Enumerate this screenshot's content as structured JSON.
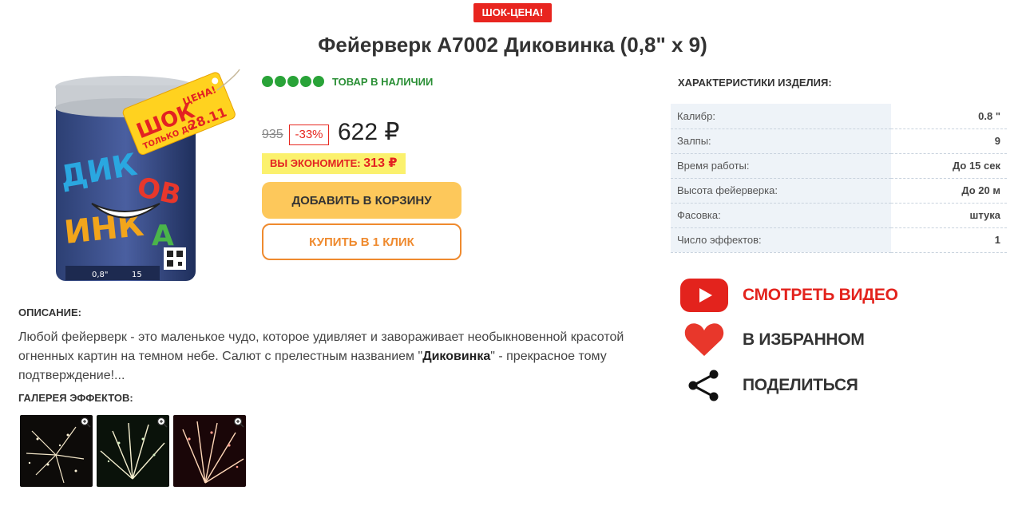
{
  "promo": {
    "badge": "ШОК-ЦЕНА!"
  },
  "product": {
    "title": "Фейерверк А7002 Диковинка (0,8\" х 9)",
    "image_name": "firework-box",
    "stock": {
      "dots": 5,
      "text": "ТОВАР В НАЛИЧИИ",
      "color": "#29a338"
    },
    "old_price": "935",
    "discount": "-33%",
    "price": "622 ₽",
    "savings_label": "ВЫ ЭКОНОМИТЕ:",
    "savings_amount": "313 ₽",
    "add_to_cart_label": "ДОБАВИТЬ В КОРЗИНУ",
    "buy_one_click_label": "КУПИТЬ В 1 КЛИК"
  },
  "specs": {
    "title": "ХАРАКТЕРИСТИКИ ИЗДЕЛИЯ:",
    "rows": [
      {
        "key": "Калибр:",
        "value": "0.8 \""
      },
      {
        "key": "Залпы:",
        "value": "9"
      },
      {
        "key": "Время работы:",
        "value": "До 15 сек"
      },
      {
        "key": "Высота фейерверка:",
        "value": "До 20 м"
      },
      {
        "key": "Фасовка:",
        "value": "штука"
      },
      {
        "key": "Число эффектов:",
        "value": "1"
      }
    ]
  },
  "actions": {
    "video": {
      "label": "СМОТРЕТЬ ВИДЕО",
      "icon": "youtube-play-icon",
      "color": "#e3231d"
    },
    "favorite": {
      "label": "В ИЗБРАННОМ",
      "icon": "heart-icon",
      "color": "#e8372b"
    },
    "share": {
      "label": "ПОДЕЛИТЬСЯ",
      "icon": "share-icon"
    }
  },
  "description": {
    "title": "ОПИСАНИЕ:",
    "text_before": "Любой фейерверк - это маленькое чудо, которое удивляет и завораживает необыкновенной красотой огненных картин на темном небе. Салют с прелестным названием \"",
    "text_bold": "Диковинка",
    "text_after": "\" - прекрасное тому подтверждение!..."
  },
  "gallery": {
    "title": "ГАЛЕРЕЯ ЭФФЕКТОВ:",
    "items": [
      {
        "icon": "zoom-in-icon",
        "tint": "#f3e6c8"
      },
      {
        "icon": "zoom-in-icon",
        "tint": "#f6f0d0"
      },
      {
        "icon": "zoom-in-icon",
        "tint": "#ffd7b8"
      }
    ]
  },
  "colors": {
    "accent_red": "#e8251f",
    "cart_button": "#fdc85b",
    "oneclick_border": "#ef8a2e",
    "savings_bg": "#fbf16d"
  }
}
